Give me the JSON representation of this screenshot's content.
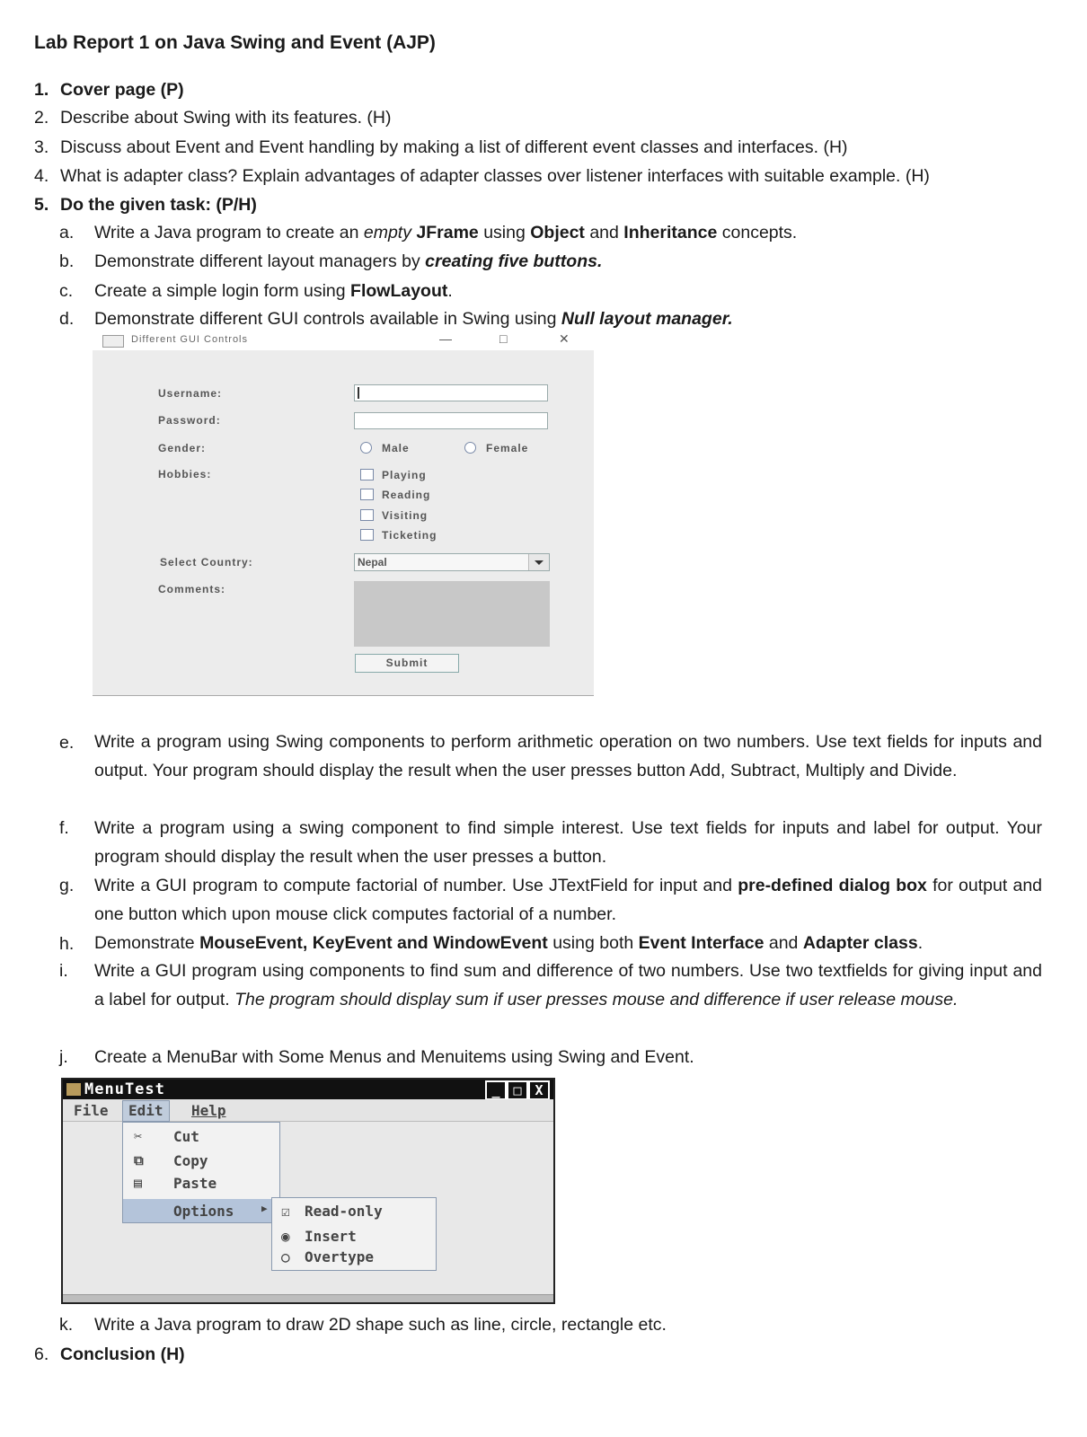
{
  "title": "Lab Report 1 on Java Swing and Event (AJP)",
  "items": {
    "i1": {
      "num": "1.",
      "text": "Cover page (P)"
    },
    "i2": {
      "num": "2.",
      "text": "Describe about Swing with its features. (H)"
    },
    "i3": {
      "num": "3.",
      "text": "Discuss about Event and Event handling by making a list of different event classes and interfaces. (H)"
    },
    "i4": {
      "num": "4.",
      "text": "What is adapter class? Explain advantages of adapter classes over listener interfaces with suitable example.  (H)"
    },
    "i5": {
      "num": "5.",
      "text": "Do the given task: (P/H)"
    },
    "i6": {
      "num": "6.",
      "text": "Conclusion (H)"
    }
  },
  "tasks": {
    "a": {
      "letter": "a.",
      "p1": "Write a Java program to create an ",
      "em1": "empty ",
      "b1": "JFrame",
      "p2": " using ",
      "b2": "Object",
      "p3": " and ",
      "b3": "Inheritance",
      "p4": " concepts."
    },
    "b": {
      "letter": "b.",
      "p1": "Demonstrate different layout managers by ",
      "bi1": "creating five buttons."
    },
    "c": {
      "letter": "c.",
      "p1": "Create a simple login form using ",
      "b1": "FlowLayout",
      "p2": "."
    },
    "d": {
      "letter": "d.",
      "p1": "Demonstrate different GUI controls available in Swing using ",
      "bi1": "Null layout manager."
    },
    "e": {
      "letter": "e.",
      "text": "Write a program using Swing components to perform arithmetic operation on two numbers. Use text fields for inputs and output. Your program should display the result when the user presses button Add, Subtract, Multiply and Divide."
    },
    "f": {
      "letter": "f.",
      "text": "Write a program using a swing component to find simple interest. Use text fields for inputs and label for output. Your program should display the result when the user presses a button."
    },
    "g": {
      "letter": "g.",
      "p1": "Write a GUI program to compute factorial of number. Use JTextField for input and ",
      "b1": "pre-defined dialog box",
      "p2": " for output and one button which upon mouse click computes factorial of a number."
    },
    "h": {
      "letter": "h.",
      "p1": "Demonstrate ",
      "b1": "MouseEvent, KeyEvent and WindowEvent",
      "p2": " using both ",
      "b2": "Event Interface",
      "p3": " and ",
      "b3": "Adapter class",
      "p4": "."
    },
    "i": {
      "letter": "i.",
      "p1": "Write a GUI program using components to find sum and difference of two numbers. Use two textfields for giving input and a label for output. ",
      "em1": "The program should display sum if user presses mouse and difference if user release mouse."
    },
    "j": {
      "letter": "j.",
      "text": "Create a MenuBar with Some Menus and Menuitems using Swing and Event."
    },
    "k": {
      "letter": "k.",
      "text": "Write a Java program to draw 2D shape such as line, circle, rectangle etc."
    }
  },
  "gui": {
    "window_title": "Different GUI Controls",
    "min": "—",
    "max": "□",
    "close": "✕",
    "username_label": "Username:",
    "password_label": "Password:",
    "gender_label": "Gender:",
    "male": "Male",
    "female": "Female",
    "hobbies_label": "Hobbies:",
    "hobbies": [
      "Playing",
      "Reading",
      "Visiting",
      "Ticketing"
    ],
    "country_label": "Select Country:",
    "country_value": "Nepal",
    "comments_label": "Comments:",
    "submit": "Submit"
  },
  "menu": {
    "window_title": "MenuTest",
    "min": "_",
    "max": "□",
    "close": "X",
    "menus": [
      "File",
      "Edit",
      "Help"
    ],
    "edit_items": [
      "Cut",
      "Copy",
      "Paste",
      "Options"
    ],
    "options_items": [
      "Read-only",
      "Insert",
      "Overtype"
    ],
    "icons": [
      "scissors-icon",
      "copy-icon",
      "paste-icon"
    ]
  }
}
